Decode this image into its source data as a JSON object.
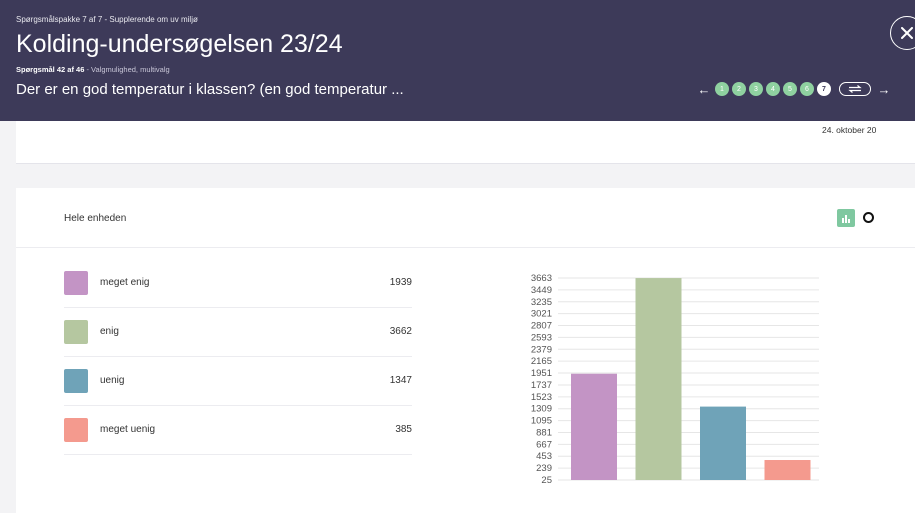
{
  "header": {
    "package_label": "Spørgsmålspakke 7 af 7 - Supplerende om uv miljø",
    "survey_title": "Kolding-undersøgelsen 23/24",
    "question_number": "Spørgsmål 42 af 46",
    "question_type": " - Valgmulighed, multivalg",
    "question_text": "Der er en god temperatur i klassen? (en god temperatur ...",
    "close_icon": "close-icon",
    "pager": {
      "prev_icon": "arrow-left-icon",
      "next_icon": "arrow-right-icon",
      "pages": [
        "1",
        "2",
        "3",
        "4",
        "5",
        "6",
        "7"
      ],
      "active_page": "7",
      "toggle_icon": "swap-icon"
    }
  },
  "info_card": {
    "date": "24. oktober 20"
  },
  "results": {
    "unit_label": "Hele enheden",
    "view_toggles": [
      "bar-chart-icon",
      "pie-chart-icon"
    ],
    "legend": [
      {
        "label": "meget enig",
        "value": "1939",
        "color": "#c394c5"
      },
      {
        "label": "enig",
        "value": "3662",
        "color": "#b5c7a0"
      },
      {
        "label": "uenig",
        "value": "1347",
        "color": "#6fa3b8"
      },
      {
        "label": "meget uenig",
        "value": "385",
        "color": "#f49a8e"
      }
    ]
  },
  "chart_data": {
    "type": "bar",
    "categories": [
      "meget enig",
      "enig",
      "uenig",
      "meget uenig"
    ],
    "values": [
      1939,
      3662,
      1347,
      385
    ],
    "colors": [
      "#c394c5",
      "#b5c7a0",
      "#6fa3b8",
      "#f49a8e"
    ],
    "yticks": [
      25,
      239,
      453,
      667,
      881,
      1095,
      1309,
      1523,
      1737,
      1951,
      2165,
      2379,
      2593,
      2807,
      3021,
      3235,
      3449,
      3663
    ],
    "ylim": [
      25,
      3663
    ],
    "grid": true
  }
}
